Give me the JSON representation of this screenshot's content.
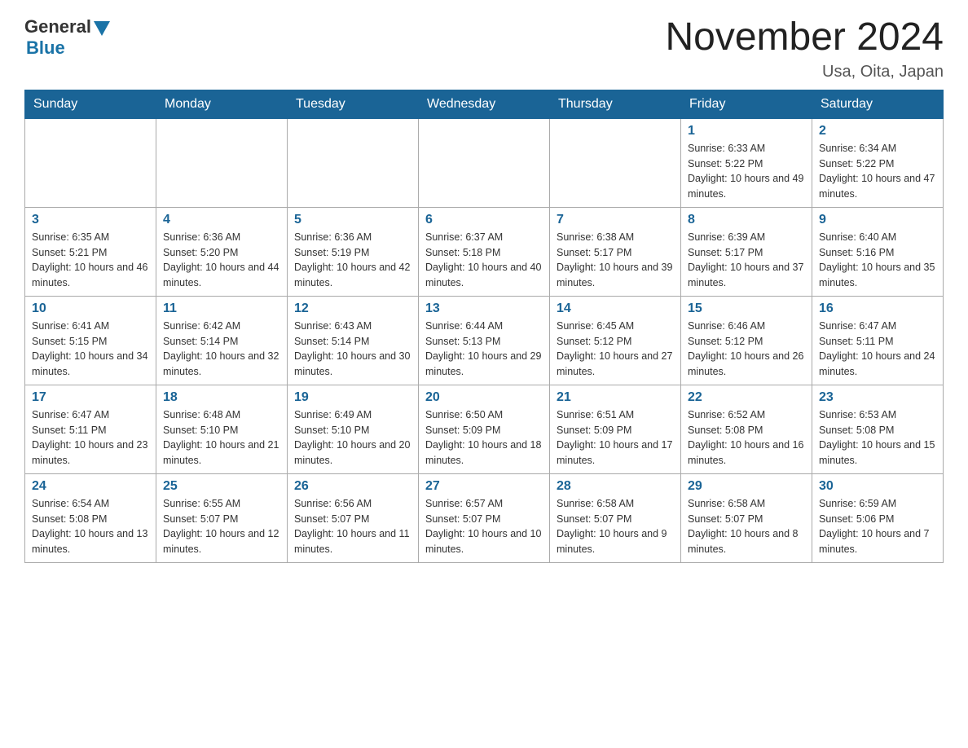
{
  "logo": {
    "general": "General",
    "blue": "Blue"
  },
  "header": {
    "month": "November 2024",
    "location": "Usa, Oita, Japan"
  },
  "weekdays": [
    "Sunday",
    "Monday",
    "Tuesday",
    "Wednesday",
    "Thursday",
    "Friday",
    "Saturday"
  ],
  "weeks": [
    [
      {
        "day": "",
        "info": ""
      },
      {
        "day": "",
        "info": ""
      },
      {
        "day": "",
        "info": ""
      },
      {
        "day": "",
        "info": ""
      },
      {
        "day": "",
        "info": ""
      },
      {
        "day": "1",
        "info": "Sunrise: 6:33 AM\nSunset: 5:22 PM\nDaylight: 10 hours and 49 minutes."
      },
      {
        "day": "2",
        "info": "Sunrise: 6:34 AM\nSunset: 5:22 PM\nDaylight: 10 hours and 47 minutes."
      }
    ],
    [
      {
        "day": "3",
        "info": "Sunrise: 6:35 AM\nSunset: 5:21 PM\nDaylight: 10 hours and 46 minutes."
      },
      {
        "day": "4",
        "info": "Sunrise: 6:36 AM\nSunset: 5:20 PM\nDaylight: 10 hours and 44 minutes."
      },
      {
        "day": "5",
        "info": "Sunrise: 6:36 AM\nSunset: 5:19 PM\nDaylight: 10 hours and 42 minutes."
      },
      {
        "day": "6",
        "info": "Sunrise: 6:37 AM\nSunset: 5:18 PM\nDaylight: 10 hours and 40 minutes."
      },
      {
        "day": "7",
        "info": "Sunrise: 6:38 AM\nSunset: 5:17 PM\nDaylight: 10 hours and 39 minutes."
      },
      {
        "day": "8",
        "info": "Sunrise: 6:39 AM\nSunset: 5:17 PM\nDaylight: 10 hours and 37 minutes."
      },
      {
        "day": "9",
        "info": "Sunrise: 6:40 AM\nSunset: 5:16 PM\nDaylight: 10 hours and 35 minutes."
      }
    ],
    [
      {
        "day": "10",
        "info": "Sunrise: 6:41 AM\nSunset: 5:15 PM\nDaylight: 10 hours and 34 minutes."
      },
      {
        "day": "11",
        "info": "Sunrise: 6:42 AM\nSunset: 5:14 PM\nDaylight: 10 hours and 32 minutes."
      },
      {
        "day": "12",
        "info": "Sunrise: 6:43 AM\nSunset: 5:14 PM\nDaylight: 10 hours and 30 minutes."
      },
      {
        "day": "13",
        "info": "Sunrise: 6:44 AM\nSunset: 5:13 PM\nDaylight: 10 hours and 29 minutes."
      },
      {
        "day": "14",
        "info": "Sunrise: 6:45 AM\nSunset: 5:12 PM\nDaylight: 10 hours and 27 minutes."
      },
      {
        "day": "15",
        "info": "Sunrise: 6:46 AM\nSunset: 5:12 PM\nDaylight: 10 hours and 26 minutes."
      },
      {
        "day": "16",
        "info": "Sunrise: 6:47 AM\nSunset: 5:11 PM\nDaylight: 10 hours and 24 minutes."
      }
    ],
    [
      {
        "day": "17",
        "info": "Sunrise: 6:47 AM\nSunset: 5:11 PM\nDaylight: 10 hours and 23 minutes."
      },
      {
        "day": "18",
        "info": "Sunrise: 6:48 AM\nSunset: 5:10 PM\nDaylight: 10 hours and 21 minutes."
      },
      {
        "day": "19",
        "info": "Sunrise: 6:49 AM\nSunset: 5:10 PM\nDaylight: 10 hours and 20 minutes."
      },
      {
        "day": "20",
        "info": "Sunrise: 6:50 AM\nSunset: 5:09 PM\nDaylight: 10 hours and 18 minutes."
      },
      {
        "day": "21",
        "info": "Sunrise: 6:51 AM\nSunset: 5:09 PM\nDaylight: 10 hours and 17 minutes."
      },
      {
        "day": "22",
        "info": "Sunrise: 6:52 AM\nSunset: 5:08 PM\nDaylight: 10 hours and 16 minutes."
      },
      {
        "day": "23",
        "info": "Sunrise: 6:53 AM\nSunset: 5:08 PM\nDaylight: 10 hours and 15 minutes."
      }
    ],
    [
      {
        "day": "24",
        "info": "Sunrise: 6:54 AM\nSunset: 5:08 PM\nDaylight: 10 hours and 13 minutes."
      },
      {
        "day": "25",
        "info": "Sunrise: 6:55 AM\nSunset: 5:07 PM\nDaylight: 10 hours and 12 minutes."
      },
      {
        "day": "26",
        "info": "Sunrise: 6:56 AM\nSunset: 5:07 PM\nDaylight: 10 hours and 11 minutes."
      },
      {
        "day": "27",
        "info": "Sunrise: 6:57 AM\nSunset: 5:07 PM\nDaylight: 10 hours and 10 minutes."
      },
      {
        "day": "28",
        "info": "Sunrise: 6:58 AM\nSunset: 5:07 PM\nDaylight: 10 hours and 9 minutes."
      },
      {
        "day": "29",
        "info": "Sunrise: 6:58 AM\nSunset: 5:07 PM\nDaylight: 10 hours and 8 minutes."
      },
      {
        "day": "30",
        "info": "Sunrise: 6:59 AM\nSunset: 5:06 PM\nDaylight: 10 hours and 7 minutes."
      }
    ]
  ]
}
